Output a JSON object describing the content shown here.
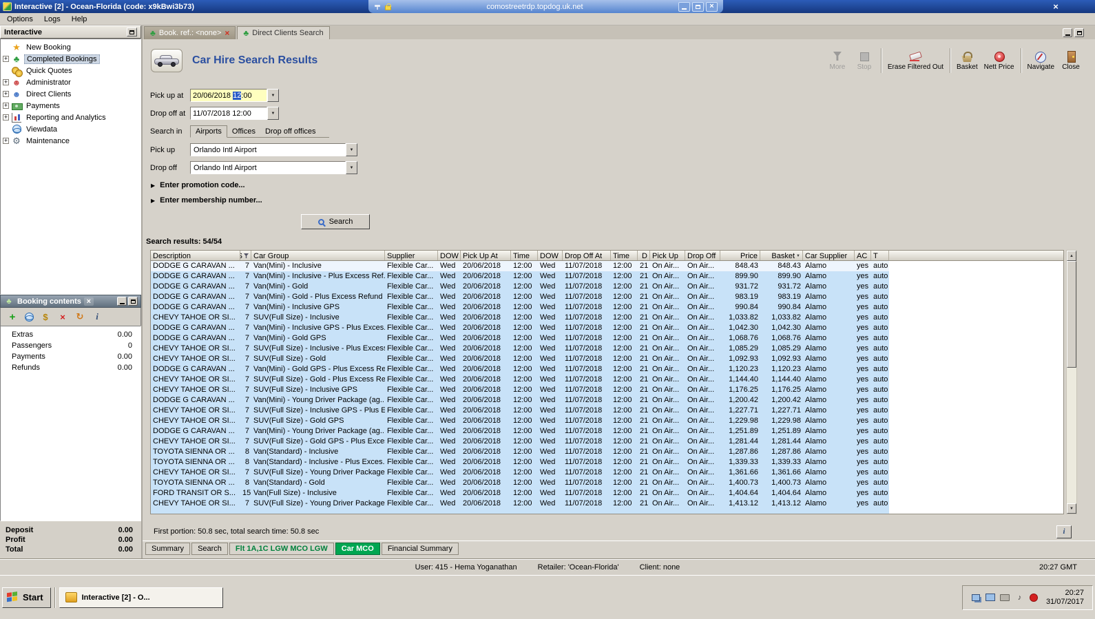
{
  "window": {
    "title": "Interactive [2] - Ocean-Florida (code: x9kBwi3b73)",
    "rdp_host": "comostreetrdp.topdog.uk.net"
  },
  "colors": {
    "accent_green": "#00a651",
    "row_blue": "#c8e2f8",
    "page_title_blue": "#2b4fa0",
    "selection_blue": "#2a5cc8",
    "input_highlight_yellow": "#ffffbf"
  },
  "menu": {
    "items": [
      "Options",
      "Logs",
      "Help"
    ]
  },
  "sidebar": {
    "title": "Interactive",
    "items": [
      {
        "label": "New Booking",
        "icon": "star",
        "plus": false,
        "selected": false
      },
      {
        "label": "Completed Bookings",
        "icon": "palm",
        "plus": true,
        "selected": true
      },
      {
        "label": "Quick Quotes",
        "icon": "coins",
        "plus": false,
        "selected": false
      },
      {
        "label": "Administrator",
        "icon": "person-red",
        "plus": true,
        "selected": false
      },
      {
        "label": "Direct Clients",
        "icon": "person-blue",
        "plus": true,
        "selected": false
      },
      {
        "label": "Payments",
        "icon": "money",
        "plus": true,
        "selected": false
      },
      {
        "label": "Reporting and Analytics",
        "icon": "chart",
        "plus": true,
        "selected": false
      },
      {
        "label": "Viewdata",
        "icon": "globe",
        "plus": false,
        "selected": false
      },
      {
        "label": "Maintenance",
        "icon": "gear",
        "plus": true,
        "selected": false
      }
    ]
  },
  "booking_contents": {
    "title": "Booking contents",
    "toolbar_icons": [
      "add",
      "world",
      "transfer",
      "delete",
      "refresh",
      "info"
    ],
    "rows": [
      {
        "label": "Extras",
        "value": "0.00"
      },
      {
        "label": "Passengers",
        "value": "0"
      },
      {
        "label": "Payments",
        "value": "0.00"
      },
      {
        "label": "Refunds",
        "value": "0.00"
      }
    ],
    "totals": [
      {
        "label": "Deposit",
        "value": "0.00"
      },
      {
        "label": "Profit",
        "value": "0.00"
      },
      {
        "label": "Total",
        "value": "0.00"
      }
    ]
  },
  "mdi_tabs": [
    {
      "label": "Book. ref.: <none>",
      "active": true,
      "closable": true
    },
    {
      "label": "Direct Clients Search",
      "active": false,
      "closable": false
    }
  ],
  "page": {
    "title": "Car Hire Search Results"
  },
  "header_toolbar": [
    {
      "label": "More",
      "icon": "filter",
      "disabled": true,
      "sep_after": false
    },
    {
      "label": "Stop",
      "icon": "stop",
      "disabled": true,
      "sep_after": true
    },
    {
      "label": "Erase Filtered Out",
      "icon": "erase",
      "disabled": false,
      "sep_after": true
    },
    {
      "label": "Basket",
      "icon": "basket",
      "disabled": false,
      "sep_after": false
    },
    {
      "label": "Nett Price",
      "icon": "rosette",
      "disabled": false,
      "sep_after": true
    },
    {
      "label": "Navigate",
      "icon": "compass",
      "disabled": false,
      "sep_after": false
    },
    {
      "label": "Close",
      "icon": "door",
      "disabled": false,
      "sep_after": false
    }
  ],
  "form": {
    "pickup_at_label": "Pick up at",
    "pickup_at": {
      "prefix": "20/06/2018 ",
      "selected": "12",
      "suffix": ":00"
    },
    "dropoff_at_label": "Drop off at",
    "dropoff_at_value": "11/07/2018 12:00",
    "search_in_label": "Search in",
    "search_in_tabs": [
      "Airports",
      "Offices",
      "Drop off offices"
    ],
    "pickup_label": "Pick up",
    "pickup_value": "Orlando Intl Airport",
    "dropoff_label": "Drop off",
    "dropoff_value": "Orlando Intl Airport",
    "promo_label": "Enter promotion code...",
    "membership_label": "Enter membership number...",
    "search_button": "Search"
  },
  "results": {
    "count_label": "Search results: 54/54",
    "footer": "First portion: 50.8 sec, total search time: 50.8 sec",
    "info_button": "i"
  },
  "table": {
    "columns": [
      {
        "label": "Description"
      },
      {
        "label": "S",
        "filter": true
      },
      {
        "label": "Car Group"
      },
      {
        "label": "Supplier"
      },
      {
        "label": "DOW"
      },
      {
        "label": "Pick Up At"
      },
      {
        "label": "Time"
      },
      {
        "label": "DOW"
      },
      {
        "label": "Drop Off At"
      },
      {
        "label": "Time"
      },
      {
        "label": "D"
      },
      {
        "label": "Pick Up"
      },
      {
        "label": "Drop Off"
      },
      {
        "label": "Price"
      },
      {
        "label": "Basket",
        "sort": "desc"
      },
      {
        "label": "Car Supplier"
      },
      {
        "label": "AC"
      },
      {
        "label": "T"
      }
    ],
    "common": {
      "supplier": "Flexible Car...",
      "dow_pick": "Wed",
      "pick_date": "20/06/2018",
      "pick_time": "12:00",
      "dow_drop": "Wed",
      "drop_date": "11/07/2018",
      "drop_time": "12:00",
      "days": "21",
      "pick_loc": "On Air...",
      "drop_loc": "On Air...",
      "car_supplier": "Alamo",
      "ac": "yes",
      "t": "auto"
    },
    "rows": [
      {
        "d": "DODGE G CARAVAN ...",
        "s": "7",
        "g": "Van(Mini) - Inclusive",
        "p": "848.43",
        "b": "848.43"
      },
      {
        "d": "DODGE G CARAVAN ...",
        "s": "7",
        "g": "Van(Mini) - Inclusive - Plus Excess Ref...",
        "p": "899.90",
        "b": "899.90"
      },
      {
        "d": "DODGE G CARAVAN ...",
        "s": "7",
        "g": "Van(Mini) - Gold",
        "p": "931.72",
        "b": "931.72"
      },
      {
        "d": "DODGE G CARAVAN ...",
        "s": "7",
        "g": "Van(Mini) - Gold - Plus Excess Refund",
        "p": "983.19",
        "b": "983.19"
      },
      {
        "d": "DODGE G CARAVAN ...",
        "s": "7",
        "g": "Van(Mini) - Inclusive GPS",
        "p": "990.84",
        "b": "990.84"
      },
      {
        "d": "CHEVY TAHOE OR SI...",
        "s": "7",
        "g": "SUV(Full Size) - Inclusive",
        "p": "1,033.82",
        "b": "1,033.82"
      },
      {
        "d": "DODGE G CARAVAN ...",
        "s": "7",
        "g": "Van(Mini) - Inclusive GPS - Plus Exces...",
        "p": "1,042.30",
        "b": "1,042.30"
      },
      {
        "d": "DODGE G CARAVAN ...",
        "s": "7",
        "g": "Van(Mini) - Gold GPS",
        "p": "1,068.76",
        "b": "1,068.76"
      },
      {
        "d": "CHEVY TAHOE OR SI...",
        "s": "7",
        "g": "SUV(Full Size) - Inclusive - Plus Excess...",
        "p": "1,085.29",
        "b": "1,085.29"
      },
      {
        "d": "CHEVY TAHOE OR SI...",
        "s": "7",
        "g": "SUV(Full Size) - Gold",
        "p": "1,092.93",
        "b": "1,092.93"
      },
      {
        "d": "DODGE G CARAVAN ...",
        "s": "7",
        "g": "Van(Mini) - Gold GPS - Plus Excess Ref...",
        "p": "1,120.23",
        "b": "1,120.23"
      },
      {
        "d": "CHEVY TAHOE OR SI...",
        "s": "7",
        "g": "SUV(Full Size) - Gold - Plus Excess Ref...",
        "p": "1,144.40",
        "b": "1,144.40"
      },
      {
        "d": "CHEVY TAHOE OR SI...",
        "s": "7",
        "g": "SUV(Full Size) - Inclusive GPS",
        "p": "1,176.25",
        "b": "1,176.25"
      },
      {
        "d": "DODGE G CARAVAN ...",
        "s": "7",
        "g": "Van(Mini) - Young Driver Package (ag...",
        "p": "1,200.42",
        "b": "1,200.42"
      },
      {
        "d": "CHEVY TAHOE OR SI...",
        "s": "7",
        "g": "SUV(Full Size) - Inclusive GPS - Plus E...",
        "p": "1,227.71",
        "b": "1,227.71"
      },
      {
        "d": "CHEVY TAHOE OR SI...",
        "s": "7",
        "g": "SUV(Full Size) - Gold GPS",
        "p": "1,229.98",
        "b": "1,229.98"
      },
      {
        "d": "DODGE G CARAVAN ...",
        "s": "7",
        "g": "Van(Mini) - Young Driver Package (ag...",
        "p": "1,251.89",
        "b": "1,251.89"
      },
      {
        "d": "CHEVY TAHOE OR SI...",
        "s": "7",
        "g": "SUV(Full Size) - Gold GPS - Plus Exces...",
        "p": "1,281.44",
        "b": "1,281.44"
      },
      {
        "d": "TOYOTA SIENNA OR ...",
        "s": "8",
        "g": "Van(Standard) - Inclusive",
        "p": "1,287.86",
        "b": "1,287.86"
      },
      {
        "d": "TOYOTA SIENNA OR ...",
        "s": "8",
        "g": "Van(Standard) - Inclusive - Plus Exces...",
        "p": "1,339.33",
        "b": "1,339.33"
      },
      {
        "d": "CHEVY TAHOE OR SI...",
        "s": "7",
        "g": "SUV(Full Size) - Young Driver Package...",
        "p": "1,361.66",
        "b": "1,361.66"
      },
      {
        "d": "TOYOTA SIENNA OR ...",
        "s": "8",
        "g": "Van(Standard) - Gold",
        "p": "1,400.73",
        "b": "1,400.73"
      },
      {
        "d": "FORD TRANSIT OR S...",
        "s": "15",
        "g": "Van(Full Size) - Inclusive",
        "p": "1,404.64",
        "b": "1,404.64"
      },
      {
        "d": "CHEVY TAHOE OR SI...",
        "s": "7",
        "g": "SUV(Full Size) - Young Driver Package...",
        "p": "1,413.12",
        "b": "1,413.12"
      }
    ]
  },
  "bottom_tabs": [
    {
      "label": "Summary",
      "cls": ""
    },
    {
      "label": "Search",
      "cls": ""
    },
    {
      "label": "Flt 1A,1C LGW MCO LGW",
      "cls": "green-text"
    },
    {
      "label": "Car MCO",
      "cls": "green-bg"
    },
    {
      "label": "Financial Summary",
      "cls": ""
    }
  ],
  "status_bar": {
    "user": "User: 415 - Hema Yoganathan",
    "retailer": "Retailer: 'Ocean-Florida'",
    "client": "Client: none",
    "time": "20:27 GMT"
  },
  "taskbar": {
    "start_label": "Start",
    "task_label": "Interactive [2] - O...",
    "tray_icons": [
      "network",
      "display",
      "printer",
      "volume",
      "alert"
    ],
    "clock_time": "20:27",
    "clock_date": "31/07/2017"
  }
}
